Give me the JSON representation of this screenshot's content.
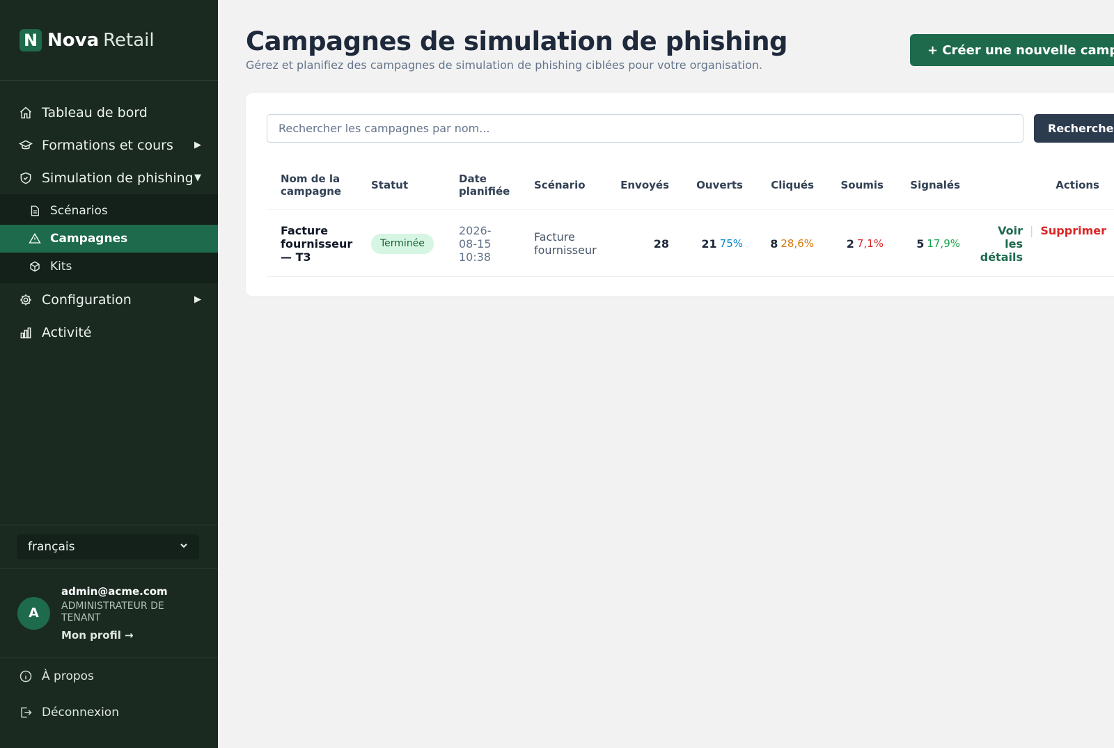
{
  "brand": {
    "logo_letter": "N",
    "name_bold": "Nova",
    "name_light": "Retail"
  },
  "nav": {
    "dashboard": "Tableau de bord",
    "training": "Formations et cours",
    "phishing": "Simulation de phishing",
    "phishing_sub": {
      "scenarios": "Scénarios",
      "campaigns": "Campagnes",
      "kits": "Kits"
    },
    "configuration": "Configuration",
    "activity": "Activité",
    "caret_right": "▶",
    "caret_down": "▼"
  },
  "language": {
    "selected": "français",
    "chevron": "⌄"
  },
  "user": {
    "avatar_letter": "A",
    "email": "admin@acme.com",
    "role": "ADMINISTRATEUR DE TENANT",
    "profile_link": "Mon profil →"
  },
  "bottom_nav": {
    "about": "À propos",
    "logout": "Déconnexion"
  },
  "page": {
    "title": "Campagnes de simulation de phishing",
    "subtitle": "Gérez et planifiez des campagnes de simulation de phishing ciblées pour votre organisation.",
    "create_button": "+ Créer une nouvelle campagne"
  },
  "search": {
    "placeholder": "Rechercher les campagnes par nom...",
    "button": "Rechercher"
  },
  "table": {
    "headers": {
      "name": "Nom de la campagne",
      "status": "Statut",
      "date": "Date planifiée",
      "scenario": "Scénario",
      "sent": "Envoyés",
      "opened": "Ouverts",
      "clicked": "Cliqués",
      "submitted": "Soumis",
      "reported": "Signalés",
      "actions": "Actions"
    },
    "rows": [
      {
        "name": "Facture fournisseur — T3",
        "status": "Terminée",
        "date": "2026-08-15 10:38",
        "scenario": "Facture fournisseur",
        "sent": "28",
        "opened": "21",
        "opened_pct": "75%",
        "clicked": "8",
        "clicked_pct": "28,6%",
        "submitted": "2",
        "submitted_pct": "7,1%",
        "reported": "5",
        "reported_pct": "17,9%",
        "action_view": "Voir les détails",
        "action_separator": "|",
        "action_delete": "Supprimer"
      }
    ]
  },
  "colors": {
    "sidebar_bg": "#1a2a21",
    "accent_green": "#1e6a4d",
    "search_button": "#2d3b4f",
    "danger": "#dc2626"
  }
}
